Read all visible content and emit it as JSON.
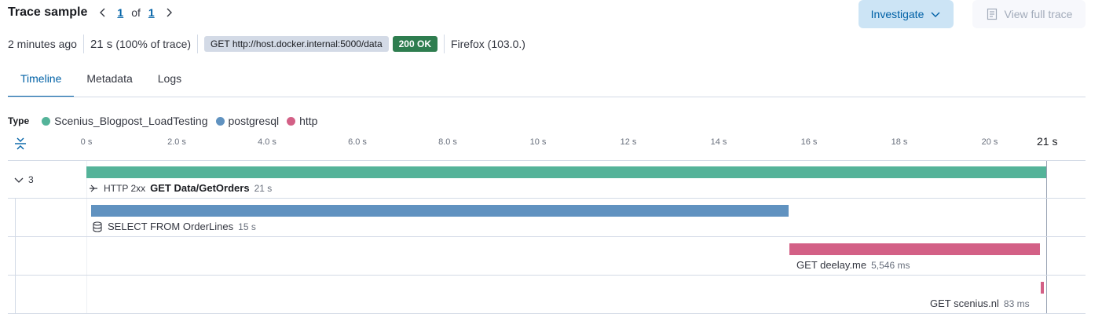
{
  "header": {
    "title": "Trace sample",
    "current_page": "1",
    "of_label": "of",
    "total_pages": "1"
  },
  "actions": {
    "investigate_label": "Investigate",
    "view_full_trace_label": "View full trace"
  },
  "meta": {
    "timestamp": "2 minutes ago",
    "duration": "21 s",
    "duration_pct": "(100% of trace)",
    "request": "GET http://host.docker.internal:5000/data",
    "status": "200 OK",
    "user_agent": "Firefox (103.0.)"
  },
  "tabs": [
    {
      "label": "Timeline",
      "active": true
    },
    {
      "label": "Metadata",
      "active": false
    },
    {
      "label": "Logs",
      "active": false
    }
  ],
  "legend": {
    "label": "Type",
    "items": [
      {
        "name": "Scenius_Blogpost_LoadTesting",
        "color": "#54b399"
      },
      {
        "name": "postgresql",
        "color": "#6092c0"
      },
      {
        "name": "http",
        "color": "#d36086"
      }
    ]
  },
  "axis": {
    "ticks": [
      "0 s",
      "2.0 s",
      "4.0 s",
      "6.0 s",
      "8.0 s",
      "10 s",
      "12 s",
      "14 s",
      "16 s",
      "18 s",
      "20 s"
    ],
    "end_label": "21 s"
  },
  "waterfall": {
    "child_count": "3",
    "spans": [
      {
        "type_label": "HTTP 2xx",
        "name": "GET Data/GetOrders",
        "duration": "21 s",
        "color": "#54b399"
      },
      {
        "name": "SELECT FROM OrderLines",
        "duration": "15 s",
        "color": "#6092c0"
      },
      {
        "name": "GET deelay.me",
        "duration": "5,546 ms",
        "color": "#d36086"
      },
      {
        "name": "GET scenius.nl",
        "duration": "83 ms",
        "color": "#d36086"
      }
    ]
  }
}
